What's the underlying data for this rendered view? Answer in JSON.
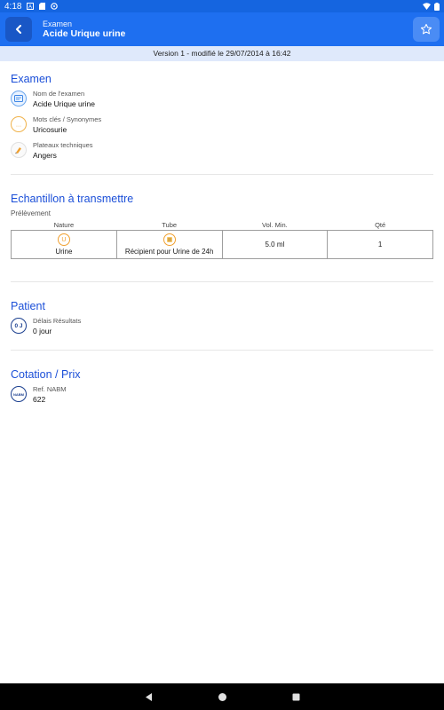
{
  "status_bar": {
    "time": "4:18"
  },
  "app_bar": {
    "subtitle": "Examen",
    "title": "Acide Urique urine"
  },
  "version_text": "Version 1 - modifié le 29/07/2014 à 16:42",
  "examen": {
    "title": "Examen",
    "rows": [
      {
        "label": "Nom de l'examen",
        "value": "Acide Urique urine",
        "icon": "exam-name-icon"
      },
      {
        "label": "Mots clés / Synonymes",
        "value": "Uricosurie",
        "icon": "keywords-icon"
      },
      {
        "label": "Plateaux techniques",
        "value": "Angers",
        "icon": "tech-platform-icon"
      }
    ]
  },
  "echantillon": {
    "title": "Echantillon à transmettre",
    "subtitle": "Prélèvement",
    "headers": [
      "Nature",
      "Tube",
      "Vol. Min.",
      "Qté"
    ],
    "row": {
      "nature": "Urine",
      "nature_icon_text": "U",
      "tube": "Récipient pour Urine de 24h",
      "vol": "5.0 ml",
      "qte": "1"
    }
  },
  "patient": {
    "title": "Patient",
    "label": "Délais Résultats",
    "value": "0 jour",
    "icon_text": "0 J"
  },
  "cotation": {
    "title": "Cotation / Prix",
    "label": "Ref. NABM",
    "value": "622",
    "icon_text": "NABM"
  },
  "colors": {
    "primary": "#1e6ff0",
    "section_title": "#1b4fd8",
    "orange": "#f0a030"
  }
}
